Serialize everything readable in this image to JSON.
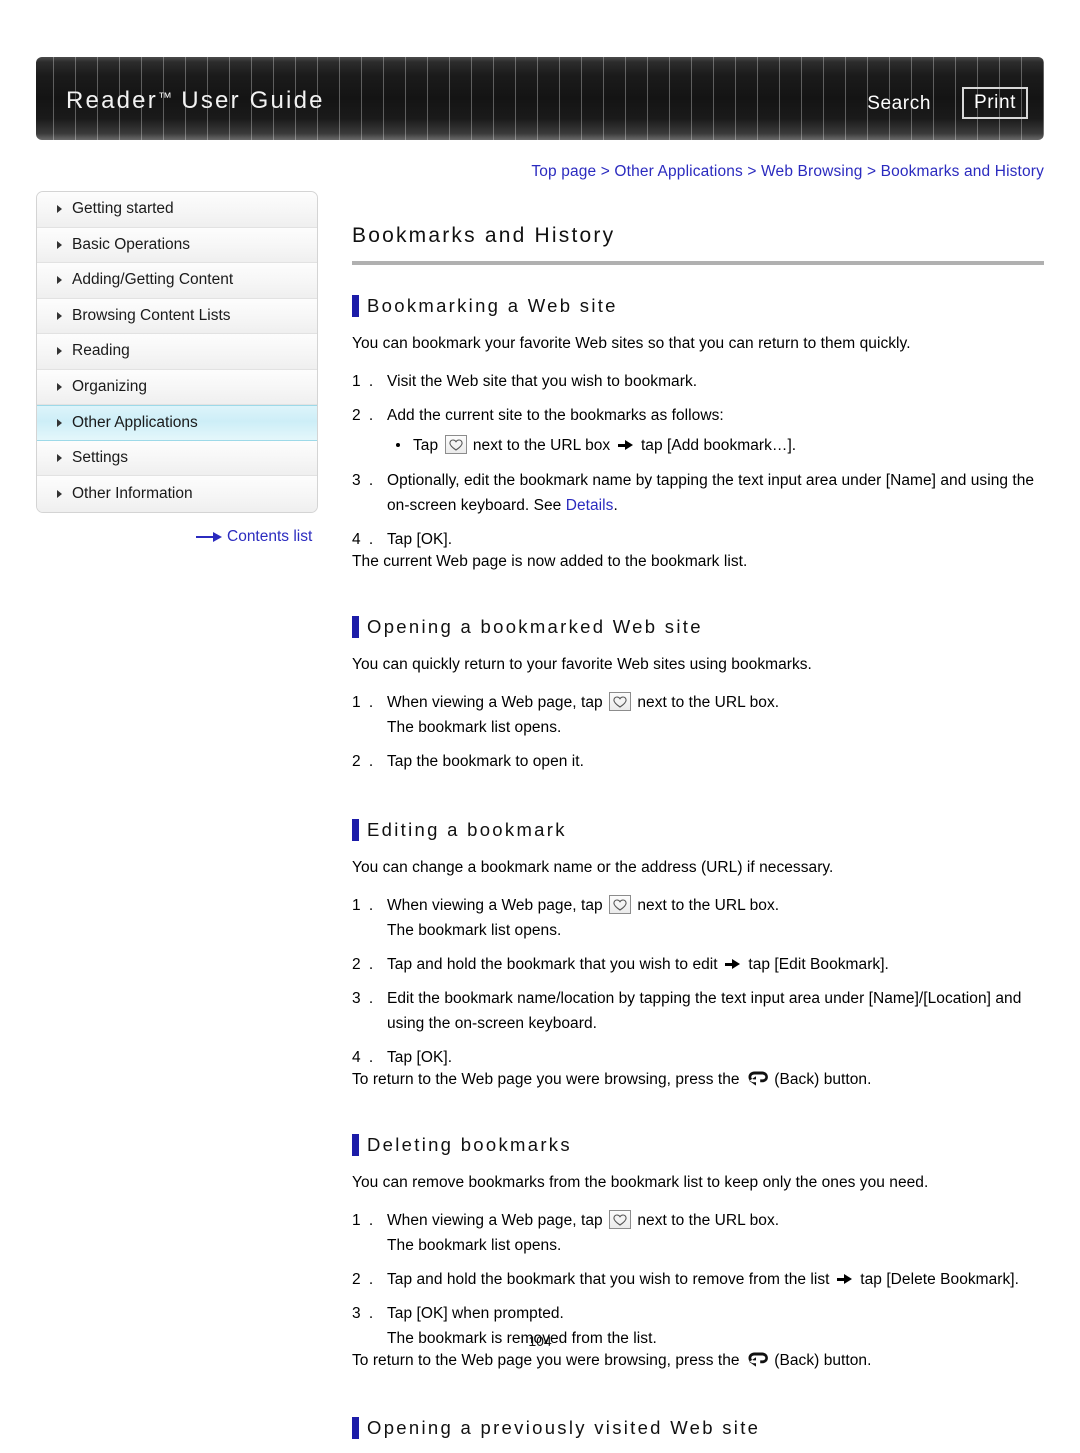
{
  "header": {
    "title_main": "Reader",
    "title_tm": "™",
    "title_rest": " User Guide",
    "search_label": "Search",
    "print_label": "Print"
  },
  "breadcrumb": {
    "items": [
      "Top page",
      "Other Applications",
      "Web Browsing",
      "Bookmarks and History"
    ],
    "separator": " > ",
    "full_text": "Top page > Other Applications > Web Browsing > Bookmarks and History"
  },
  "sidebar": {
    "items": [
      {
        "label": "Getting started",
        "active": false
      },
      {
        "label": "Basic Operations",
        "active": false
      },
      {
        "label": "Adding/Getting Content",
        "active": false
      },
      {
        "label": "Browsing Content Lists",
        "active": false
      },
      {
        "label": "Reading",
        "active": false
      },
      {
        "label": "Organizing",
        "active": false
      },
      {
        "label": "Other Applications",
        "active": true
      },
      {
        "label": "Settings",
        "active": false
      },
      {
        "label": "Other Information",
        "active": false
      }
    ],
    "contents_list_label": "Contents list"
  },
  "main": {
    "page_title": "Bookmarks and History",
    "sections": [
      {
        "heading": "Bookmarking a Web site",
        "intro": "You can bookmark your favorite Web sites so that you can return to them quickly.",
        "steps": [
          {
            "num": "1 .",
            "text": "Visit the Web site that you wish to bookmark."
          },
          {
            "num": "2 .",
            "text": "Add the current site to the bookmarks as follows:",
            "bullets": [
              {
                "pre": "Tap ",
                "icon": "bookmark-icon",
                "mid": " next to the URL box ",
                "arrow": "arrow-icon",
                "post": " tap [Add bookmark…]."
              }
            ]
          },
          {
            "num": "3 .",
            "text": "Optionally, edit the bookmark name by tapping the text input area under [Name] and using the on-screen keyboard. See ",
            "link": "Details",
            "text_after": "."
          },
          {
            "num": "4 .",
            "text": "Tap [OK]."
          }
        ],
        "trailing": "The current Web page is now added to the bookmark list."
      },
      {
        "heading": "Opening a bookmarked Web site",
        "intro": "You can quickly return to your favorite Web sites using bookmarks.",
        "steps": [
          {
            "num": "1 .",
            "pre": "When viewing a Web page, tap ",
            "icon": "bookmark-icon",
            "post": " next to the URL box.",
            "subline": "The bookmark list opens."
          },
          {
            "num": "2 .",
            "text": "Tap the bookmark to open it."
          }
        ],
        "trailing": ""
      },
      {
        "heading": "Editing a bookmark",
        "intro": "You can change a bookmark name or the address (URL) if necessary.",
        "steps": [
          {
            "num": "1 .",
            "pre": "When viewing a Web page, tap ",
            "icon": "bookmark-icon",
            "post": " next to the URL box.",
            "subline": "The bookmark list opens."
          },
          {
            "num": "2 .",
            "pre": "Tap and hold the bookmark that you wish to edit ",
            "arrow": "arrow-icon",
            "post": " tap [Edit Bookmark]."
          },
          {
            "num": "3 .",
            "text": "Edit the bookmark name/location by tapping the text input area under [Name]/[Location] and using the on-screen keyboard."
          },
          {
            "num": "4 .",
            "text": "Tap [OK]."
          }
        ],
        "trailing_pre": "To return to the Web page you were browsing, press the ",
        "trailing_icon": "back-icon",
        "trailing_post": " (Back) button."
      },
      {
        "heading": "Deleting bookmarks",
        "intro": "You can remove bookmarks from the bookmark list to keep only the ones you need.",
        "steps": [
          {
            "num": "1 .",
            "pre": "When viewing a Web page, tap ",
            "icon": "bookmark-icon",
            "post": " next to the URL box.",
            "subline": "The bookmark list opens."
          },
          {
            "num": "2 .",
            "pre": "Tap and hold the bookmark that you wish to remove from the list ",
            "arrow": "arrow-icon",
            "post": " tap [Delete Bookmark]."
          },
          {
            "num": "3 .",
            "text": "Tap [OK] when prompted.",
            "subline": "The bookmark is removed from the list."
          }
        ],
        "trailing_pre": "To return to the Web page you were browsing, press the ",
        "trailing_icon": "back-icon",
        "trailing_post": " (Back) button."
      },
      {
        "heading": "Opening a previously visited Web site"
      }
    ]
  },
  "footer": {
    "page_number": "104"
  },
  "colors": {
    "link": "#2b2bbf",
    "section_bar": "#1c1ca8",
    "header_bg": "#141414",
    "active_nav": "#cdeef7",
    "rule": "#b0b0b0"
  }
}
